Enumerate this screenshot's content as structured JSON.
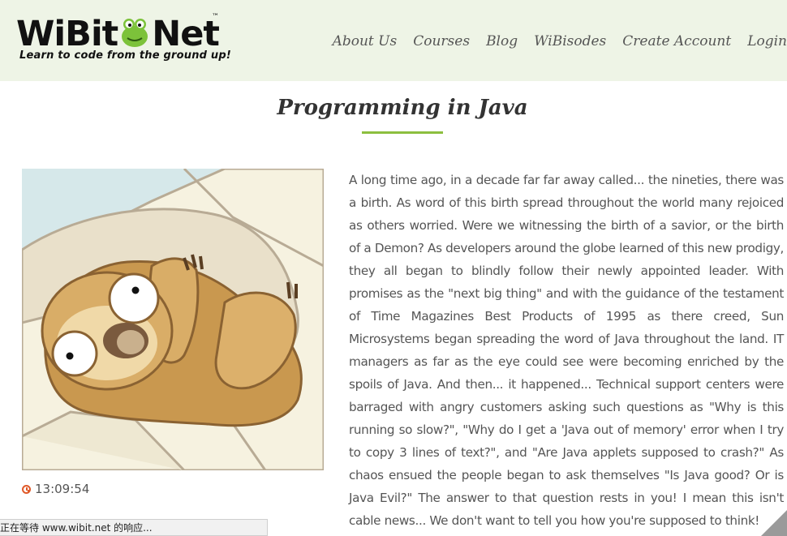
{
  "header": {
    "logo_text_left": "WiBit",
    "logo_text_right": "Net",
    "logo_tm": "™",
    "logo_tagline": "Learn to code from the ground up!"
  },
  "nav": {
    "items": [
      "About Us",
      "Courses",
      "Blog",
      "WiBisodes",
      "Create Account",
      "Login"
    ]
  },
  "page": {
    "title": "Programming in Java",
    "time": "13:09:54",
    "article": "A long time ago, in a decade far far away called... the nineties, there was a birth. As word of this birth spread throughout the world many rejoiced as others worried. Were we witnessing the birth of a savior, or the birth of a Demon? As developers around the globe learned of this new prodigy, they all began to blindly follow their newly appointed leader. With promises as the \"next big thing\" and with the guidance of the testament of Time Magazines Best Products of 1995 as there creed, Sun Microsystems began spreading the word of Java throughout the land. IT managers as far as the eye could see were becoming enriched by the spoils of Java. And then... it happened... Technical support centers were barraged with angry customers asking such questions as \"Why is this running so slow?\", \"Why do I get a 'Java out of memory' error when I try to copy 3 lines of text?\", and \"Are Java applets supposed to crash?\" As chaos ensued the people began to ask themselves \"Is Java good? Or is Java Evil?\" The answer to that question rests in you! I mean this isn't cable news... We don't want to tell you how you're supposed to think!"
  },
  "status_bar": {
    "text": "正在等待 www.wibit.net 的响应..."
  },
  "colors": {
    "header_bg": "#eef4e6",
    "accent": "#8cbf3f",
    "clock": "#e05a2a"
  }
}
